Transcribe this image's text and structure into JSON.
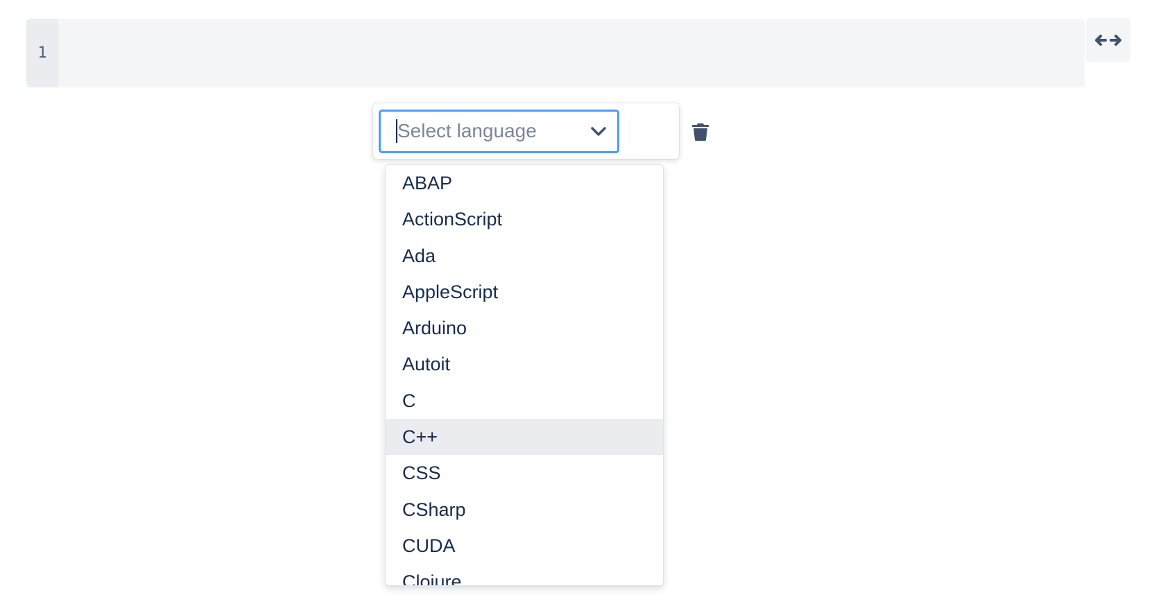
{
  "editor": {
    "line_numbers": [
      "1"
    ]
  },
  "toolbar": {
    "placeholder": "Select language"
  },
  "languages": [
    "ABAP",
    "ActionScript",
    "Ada",
    "AppleScript",
    "Arduino",
    "Autoit",
    "C",
    "C++",
    "CSS",
    "CSharp",
    "CUDA",
    "Clojure"
  ],
  "highlighted": "C++"
}
